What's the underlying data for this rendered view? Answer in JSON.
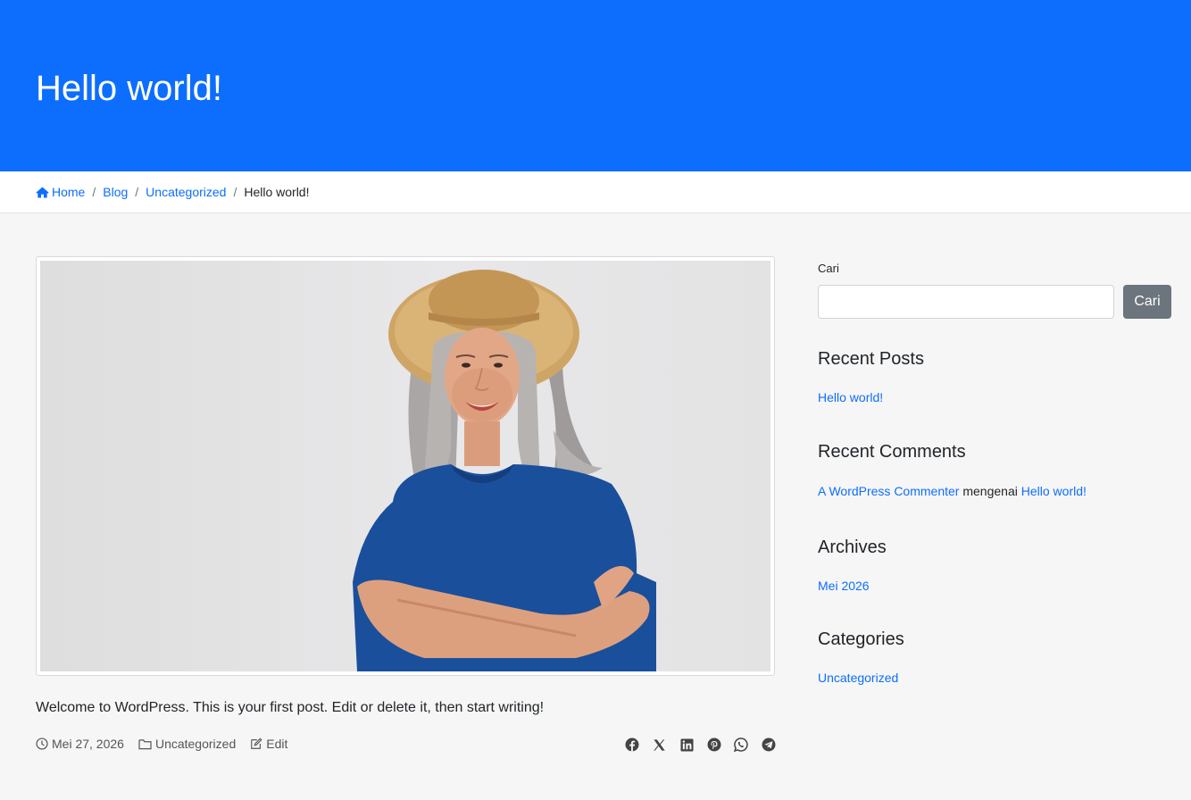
{
  "header": {
    "title": "Hello world!"
  },
  "breadcrumb": {
    "items": [
      {
        "label": "Home",
        "icon": "home-icon"
      },
      {
        "label": "Blog"
      },
      {
        "label": "Uncategorized"
      }
    ],
    "current": "Hello world!",
    "separator": "/"
  },
  "post": {
    "content": "Welcome to WordPress. This is your first post. Edit or delete it, then start writing!",
    "meta": {
      "date": "Mei 27, 2026",
      "category": "Uncategorized",
      "edit_label": "Edit"
    },
    "share_icons": [
      "facebook-icon",
      "x-icon",
      "linkedin-icon",
      "pinterest-icon",
      "whatsapp-icon",
      "telegram-icon"
    ]
  },
  "sidebar": {
    "search": {
      "label": "Cari",
      "placeholder": "",
      "button": "Cari"
    },
    "recent_posts": {
      "title": "Recent Posts",
      "items": [
        "Hello world!"
      ]
    },
    "recent_comments": {
      "title": "Recent Comments",
      "author": "A WordPress Commenter",
      "connector": "mengenai",
      "post": "Hello world!"
    },
    "archives": {
      "title": "Archives",
      "items": [
        "Mei 2026"
      ]
    },
    "categories": {
      "title": "Categories",
      "items": [
        "Uncategorized"
      ]
    }
  },
  "colors": {
    "primary": "#0d6efd",
    "background": "#f6f6f6",
    "button": "#6c757d"
  }
}
